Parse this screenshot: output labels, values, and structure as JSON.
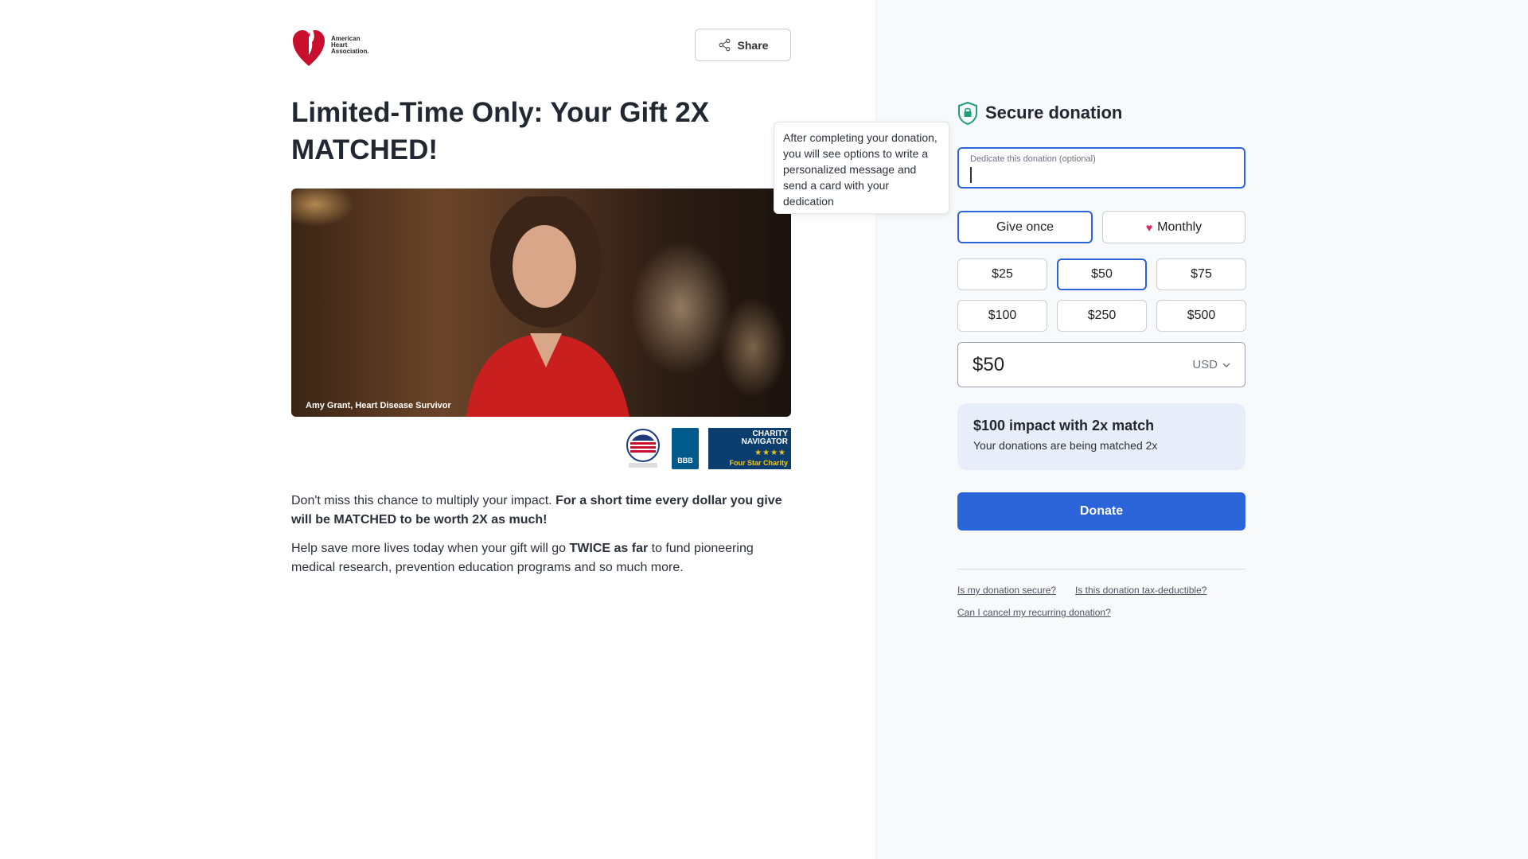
{
  "brand": {
    "name_line1": "American",
    "name_line2": "Heart",
    "name_line3": "Association."
  },
  "header": {
    "share_label": "Share"
  },
  "main": {
    "headline": "Limited-Time Only: Your Gift 2X MATCHED!",
    "hero_caption": "Amy Grant, Heart Disease Survivor",
    "para1_start": "Don't miss this chance to multiply your impact. ",
    "para1_bold": "For a short time every dollar you give will be MATCHED to be worth 2X as much!",
    "para2_start": "Help save more lives today when your gift will go ",
    "para2_bold": "TWICE as far",
    "para2_end": " to fund pioneering medical research, prevention education programs and so much more."
  },
  "badges": {
    "bbb_label": "BBB",
    "cn_line1": "CHARITY",
    "cn_line2": "NAVIGATOR",
    "cn_stars": "★★★★",
    "cn_bottom": "Four Star Charity"
  },
  "tooltip": {
    "text": "After completing your donation, you will see options to write a personalized message and send a card with your dedication"
  },
  "form": {
    "title": "Secure donation",
    "dedicate_label": "Dedicate this donation (optional)",
    "dedicate_value": "",
    "give_once": "Give once",
    "monthly": "Monthly",
    "amounts": [
      "$25",
      "$50",
      "$75",
      "$100",
      "$250",
      "$500"
    ],
    "selected_amount": "$50",
    "amount_value": "$50",
    "currency": "USD",
    "impact_title": "$100 impact with 2x match",
    "impact_sub": "Your donations are being matched 2x",
    "donate_label": "Donate",
    "faq": [
      "Is my donation secure?",
      "Is this donation tax-deductible?",
      "Can I cancel my recurring donation?"
    ]
  },
  "colors": {
    "accent": "#2b63d9",
    "impact_bg": "#e8eef9",
    "heart": "#e0245e",
    "brand_red": "#c8102e"
  }
}
